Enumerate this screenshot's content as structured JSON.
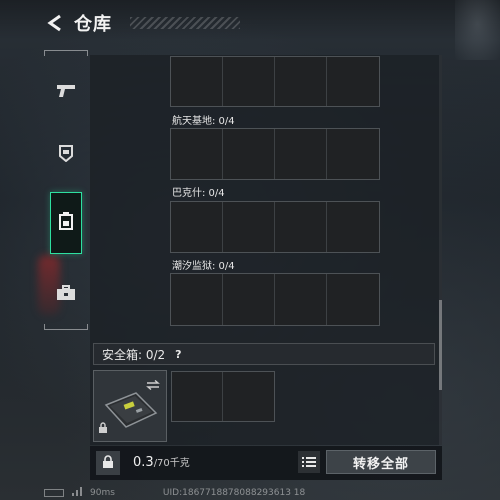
{
  "header": {
    "title": "仓库"
  },
  "sidebar": {
    "items": [
      {
        "icon": "pistol-icon"
      },
      {
        "icon": "helmet-icon"
      },
      {
        "icon": "backpack-icon",
        "active": true
      },
      {
        "icon": "toolbox-icon"
      }
    ]
  },
  "containers": [
    {
      "label": "航天基地: 0/4"
    },
    {
      "label": "巴克什: 0/4"
    },
    {
      "label": "潮汐监狱: 0/4"
    }
  ],
  "safe_box": {
    "label": "安全箱: 0/2",
    "help": "?"
  },
  "bottom_bar": {
    "weight_current": "0.3",
    "weight_max": "/70千克",
    "transfer_all_label": "转移全部"
  },
  "status_bar": {
    "ping": "90ms",
    "uid": "UID:1867718878088293613 18"
  },
  "colors": {
    "accent": "#2ee0a0"
  }
}
